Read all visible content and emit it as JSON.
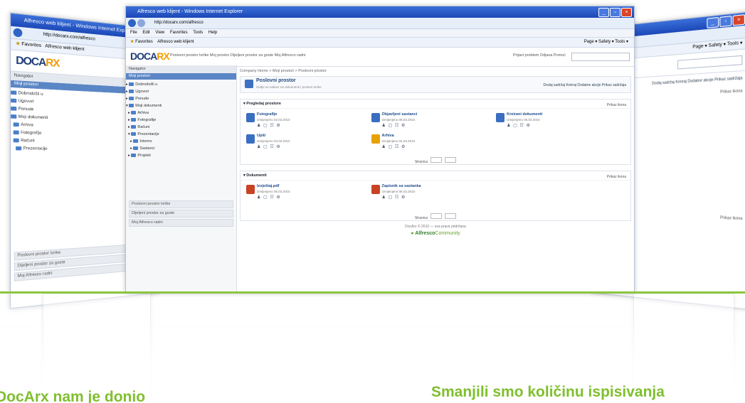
{
  "browser": {
    "window_title": "Alfresco web klijent - Windows Internet Explorer",
    "address": "http://docarx.com/alfresco",
    "menu": [
      "File",
      "Edit",
      "View",
      "Favorites",
      "Tools",
      "Help"
    ],
    "favorites_label": "Favorites",
    "tab_label": "Alfresco web klijent",
    "toolbar_right": "Page ▾  Safety ▾  Tools ▾"
  },
  "app": {
    "logo_main": "DOCA",
    "logo_accent": "RX",
    "site_nav": "Poslovni prostor tvrtke  Moj prostor  Dijeljeni prostor za goste  Moj Alfresco radni",
    "header_tools": "Prijavi problem  Odjava  Pomoć",
    "search_placeholder": ""
  },
  "sidebar": {
    "header": "Navigator",
    "selected": "Moji prostori",
    "tree": [
      "Dobrodošli u",
      "Ugovori",
      "Ponude",
      "Moji dokumenti",
      "Arhiva",
      "Fotografije",
      "Računi",
      "Prezentacije",
      "Interno",
      "Sastanci",
      "Projekti"
    ],
    "links": [
      "Poslovni prostor tvrtke",
      "Dijeljeni prostor za goste",
      "Moj Alfresco radni"
    ]
  },
  "main": {
    "breadcrumb": "Company Home > Moji prostori > Poslovni prostor",
    "folder_title": "Poslovni prostor",
    "folder_subtitle": "Ovdje se nalaze svi dokumenti i prostori tvrtke",
    "folder_actions": "Dodaj sadržaj  Kreiraj  Dodatne akcije  Prikaz sadržaja",
    "spaces_title": "Pregledaj prostore",
    "spaces_view": "Prikaz ikona",
    "spaces": [
      {
        "name": "Fotografije",
        "meta": "Izmijenjeno 02.03.2010"
      },
      {
        "name": "Objavljeni sastanci",
        "meta": "Izmijenjeno 08.03.2010"
      },
      {
        "name": "Kreirani dokumenti",
        "meta": "Izmijenjeno 05.03.2010"
      },
      {
        "name": "Upiti",
        "meta": "Izmijenjeno 03.03.2010"
      },
      {
        "name": "Arhiva",
        "meta": "Izmijenjeno 04.03.2010"
      }
    ],
    "actions_glyphs": "♟ ▢ ☷ ⚙",
    "pager_label": "Stranica",
    "docs_title": "Dokumenti",
    "docs_view": "Prikaz ikona",
    "documents": [
      {
        "name": "Izvještaj.pdf",
        "meta": "Izmijenjeno 05.03.2010"
      },
      {
        "name": "Zapisnik sa sastanka",
        "meta": "Izmijenjeno 06.03.2010"
      }
    ],
    "footer_text": "DocArx © 2010 — sva prava pridržana",
    "footer_logo_a": "Alfresco",
    "footer_logo_b": "Community"
  },
  "captions": {
    "left": "DocArx nam je donio",
    "right": "Smanjili smo količinu ispisivanja"
  },
  "colors": {
    "accent_green": "#7fbf2e",
    "titlebar_blue": "#2a5ccc",
    "logo_blue": "#1f3f7a",
    "logo_orange": "#f29b00"
  }
}
